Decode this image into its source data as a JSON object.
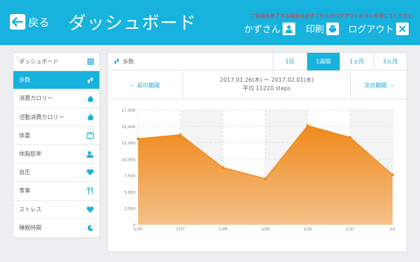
{
  "header": {
    "back_label": "戻る",
    "title": "ダッシュボード",
    "notice": "ご利用を終了する場合は必ずこちらのログアウトボタンを押してください",
    "user_name": "かずさん",
    "print_label": "印刷",
    "logout_label": "ログアウト",
    "bg_color": "#17b2dd"
  },
  "sidebar": {
    "items": [
      {
        "label": "ダッシュボード",
        "icon": "grid-icon",
        "active": false
      },
      {
        "label": "歩数",
        "icon": "footsteps-icon",
        "active": true
      },
      {
        "label": "消費カロリー",
        "icon": "flame-icon",
        "active": false
      },
      {
        "label": "活動消費カロリー",
        "icon": "flame-icon",
        "active": false
      },
      {
        "label": "体重",
        "icon": "scale-icon",
        "active": false
      },
      {
        "label": "体脂肪率",
        "icon": "body-fat-icon",
        "active": false
      },
      {
        "label": "血圧",
        "icon": "heart-icon",
        "active": false
      },
      {
        "label": "食事",
        "icon": "fork-knife-icon",
        "active": false
      },
      {
        "label": "ストレス",
        "icon": "heart-icon",
        "active": false
      },
      {
        "label": "睡眠時間",
        "icon": "moon-icon",
        "active": false
      }
    ]
  },
  "panel": {
    "name": "歩数",
    "tabs": [
      "1日",
      "1週間",
      "1ヵ月",
      "3ヵ月"
    ],
    "active_tab": 1,
    "prev_label": "前の期間",
    "next_label": "次の期間",
    "date_range": "2017.01.26(木) 〜 2017.02.01(水)",
    "average": "平均 11220 steps"
  },
  "chart_data": {
    "type": "area",
    "categories": [
      "1/26",
      "1/27",
      "1/28",
      "1/29",
      "1/30",
      "1/31",
      "2/1"
    ],
    "values": [
      13100,
      13700,
      8700,
      7000,
      15100,
      13300,
      7600
    ],
    "ylim": [
      0,
      17500
    ],
    "yticks": [
      0,
      2500,
      5000,
      7500,
      10000,
      12500,
      15000,
      17500
    ],
    "ytick_labels": [
      "0",
      "2,500",
      "5,000",
      "7,500",
      "10,000",
      "12,500",
      "15,000",
      "17,500"
    ],
    "grid": true,
    "color": "#f08a1e"
  }
}
